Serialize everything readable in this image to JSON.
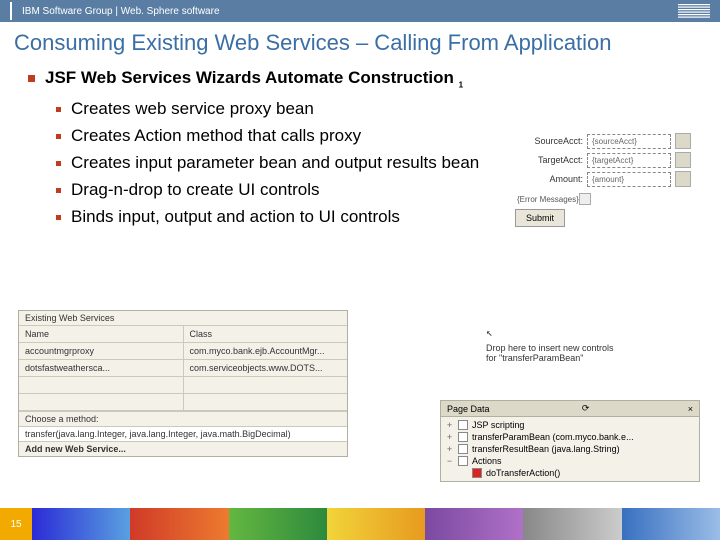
{
  "topbar": {
    "text": "IBM Software Group  |  Web. Sphere software",
    "logo_alt": "IBM"
  },
  "title": "Consuming Existing Web Services – Calling From Application",
  "heading": "JSF Web Services Wizards Automate Construction",
  "heading_footnote": "1",
  "bullets": [
    "Creates web service proxy bean",
    "Creates Action method that calls proxy",
    "Creates input parameter bean and output results bean",
    "Drag-n-drop to create UI controls",
    "Binds input, output and action to UI controls"
  ],
  "ws_panel": {
    "title": "Existing Web Services",
    "col1": "Name",
    "col2": "Class",
    "rows": [
      {
        "name": "accountmgrproxy",
        "cls": "com.myco.bank.ejb.AccountMgr..."
      },
      {
        "name": "dotsfastweathersca...",
        "cls": "com.serviceobjects.www.DOTS..."
      }
    ],
    "choose_label": "Choose a method:",
    "method": "transfer(java.lang.Integer, java.lang.Integer, java.math.BigDecimal)",
    "add_button": "Add new Web Service..."
  },
  "drop_hint": {
    "cursor_glyph": "↖",
    "text": "Drop here to insert new controls for \"transferParamBean\""
  },
  "form": {
    "rows": [
      {
        "label": "SourceAcct:",
        "value": "{sourceAcct}"
      },
      {
        "label": "TargetAcct:",
        "value": "{targetAcct}"
      },
      {
        "label": "Amount:",
        "value": "{amount}"
      }
    ],
    "error_label": "{Error Messages}",
    "submit": "Submit"
  },
  "page_data": {
    "title": "Page Data",
    "nodes": [
      {
        "indent": 0,
        "label": "JSP scripting"
      },
      {
        "indent": 0,
        "label": "transferParamBean (com.myco.bank.e..."
      },
      {
        "indent": 0,
        "label": "transferResultBean (java.lang.String)"
      },
      {
        "indent": 0,
        "label": "Actions"
      },
      {
        "indent": 1,
        "label": "doTransferAction()"
      }
    ]
  },
  "page_number": "15"
}
